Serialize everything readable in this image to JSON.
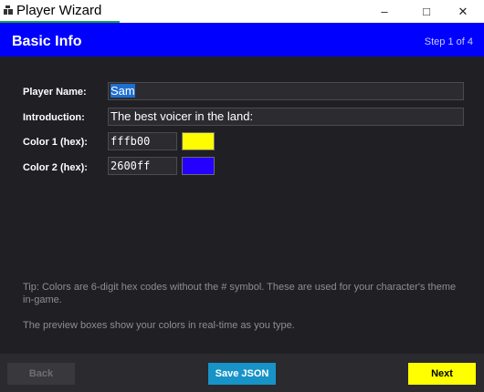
{
  "window": {
    "title": "Player Wizard",
    "minimize_glyph": "–",
    "maximize_glyph": "□",
    "close_glyph": "✕"
  },
  "header": {
    "title": "Basic Info",
    "step": "Step 1 of 4",
    "background_color": "#0000ff"
  },
  "form": {
    "player_name_label": "Player Name:",
    "player_name_value": "Sam",
    "introduction_label": "Introduction:",
    "introduction_value": "The best voicer in the land:",
    "color1_label": "Color 1 (hex):",
    "color1_value": "fffb00",
    "color1_swatch": "#fffb00",
    "color2_label": "Color 2 (hex):",
    "color2_value": "2600ff",
    "color2_swatch": "#2600ff"
  },
  "tips": {
    "tip1": "Tip: Colors are 6-digit hex codes without the # symbol. These are used for your character's theme in-game.",
    "tip2": "The preview boxes show your colors in real-time as you type."
  },
  "footer": {
    "back_label": "Back",
    "save_label": "Save JSON",
    "next_label": "Next"
  },
  "icons": {
    "app": "app-icon",
    "minimize": "minimize-icon",
    "maximize": "maximize-icon",
    "close": "close-icon"
  }
}
